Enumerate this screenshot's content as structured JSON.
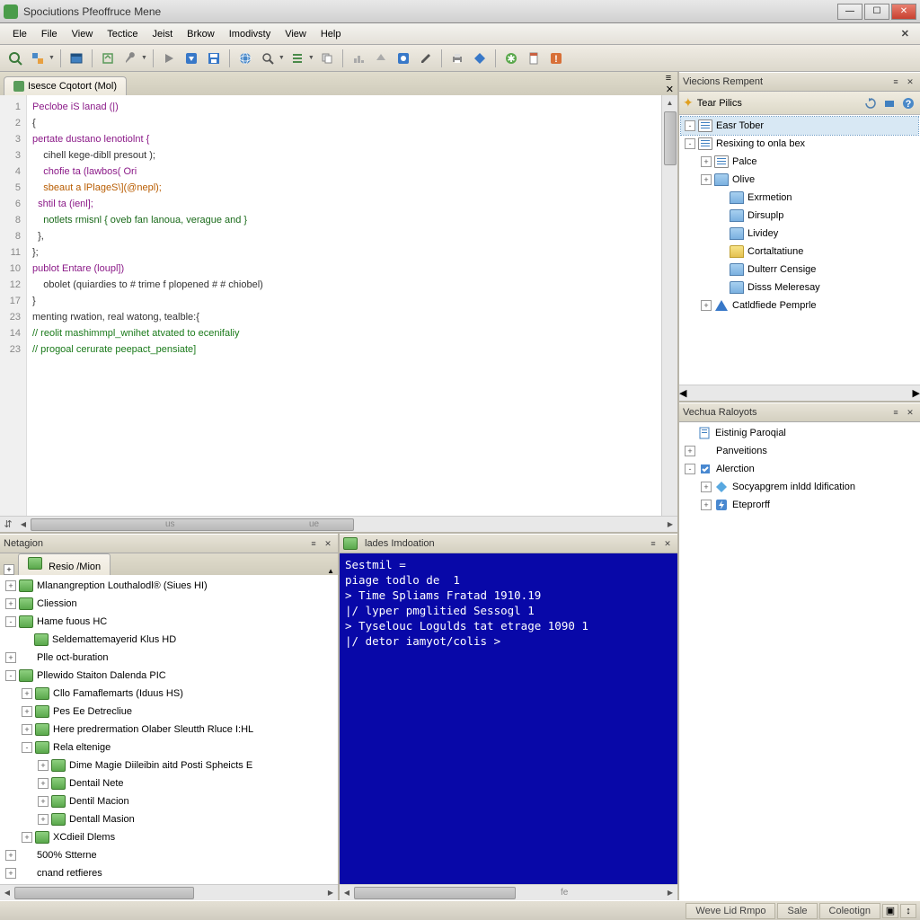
{
  "window": {
    "title": "Spociutions Pfeoffruce Mene"
  },
  "menu": {
    "items": [
      "Ele",
      "File",
      "View",
      "Tectice",
      "Jeist",
      "Brkow",
      "Imodivsty",
      "View",
      "Help"
    ]
  },
  "toolbar": {
    "icons": [
      "search",
      "puzzle",
      "window",
      "nav",
      "wrench",
      "play",
      "down",
      "save",
      "globe",
      "zoom",
      "list",
      "copy",
      "chart",
      "up",
      "box",
      "rotate",
      "pencil",
      "print",
      "diamond",
      "star",
      "page",
      "warn"
    ]
  },
  "editor": {
    "tab_label": "Isesce Cqotort (Mol)",
    "line_numbers": [
      "1",
      "2",
      "3",
      "3",
      "4",
      "5",
      "6",
      "8",
      "8",
      "",
      "11",
      "10",
      "12",
      "17",
      "23",
      "14",
      "23"
    ],
    "lines": [
      {
        "t": "Peclobe iS lanad (|)",
        "c": "kw"
      },
      {
        "t": "{",
        "c": ""
      },
      {
        "t": "pertate dustano lenotiolnt {",
        "c": "kw"
      },
      {
        "t": "    cihell kege-dibll presout );",
        "c": ""
      },
      {
        "t": "    chofie ta (lawbos( Ori",
        "c": "kw"
      },
      {
        "t": "    sbeaut a lPlageS\\](@nepl);",
        "c": "num"
      },
      {
        "t": "  shtil ta (ienl];",
        "c": "kw"
      },
      {
        "t": "    notlets rmisnl { oveb fan lanoua, verague and }",
        "c": "str"
      },
      {
        "t": "  },",
        "c": ""
      },
      {
        "t": "};",
        "c": ""
      },
      {
        "t": "",
        "c": ""
      },
      {
        "t": "publot Entare (loupl])",
        "c": "kw"
      },
      {
        "t": "    obolet (quiardies to # trime f plopened # # chiobel)",
        "c": ""
      },
      {
        "t": "}",
        "c": ""
      },
      {
        "t": "",
        "c": ""
      },
      {
        "t": "menting rwation, real watong, tealble:{",
        "c": ""
      },
      {
        "t": "// reolit mashimmpl_wnihet atvated to ecenifaliy",
        "c": "cmt"
      },
      {
        "t": "// progoal cerurate peepact_pensiate]",
        "c": "cmt"
      }
    ],
    "hscroll_labels": {
      "a": "us",
      "b": "ue"
    }
  },
  "right_panel_a": {
    "title": "Viecions Rempent",
    "toolbar_label": "Tear Pilics",
    "tree": [
      {
        "d": 0,
        "exp": "-",
        "icon": "page",
        "label": "Easr Tober",
        "sel": true
      },
      {
        "d": 0,
        "exp": "-",
        "icon": "page",
        "label": "Resixing to onla bex"
      },
      {
        "d": 1,
        "exp": "+",
        "icon": "page",
        "label": "Palce"
      },
      {
        "d": 1,
        "exp": "+",
        "icon": "bluef",
        "label": "Olive"
      },
      {
        "d": 2,
        "exp": "",
        "icon": "bluef",
        "label": "Exrmetion"
      },
      {
        "d": 2,
        "exp": "",
        "icon": "bluef",
        "label": "Dirsuplp"
      },
      {
        "d": 2,
        "exp": "",
        "icon": "bluef",
        "label": "Lividey"
      },
      {
        "d": 2,
        "exp": "",
        "icon": "folder",
        "label": "Cortaltatiune"
      },
      {
        "d": 2,
        "exp": "",
        "icon": "bluef",
        "label": "Dulterr Censige"
      },
      {
        "d": 2,
        "exp": "",
        "icon": "bluef",
        "label": "Disss Meleresay"
      },
      {
        "d": 1,
        "exp": "+",
        "icon": "tri",
        "label": "Catldfiede Pemprle"
      }
    ]
  },
  "right_panel_b": {
    "title": "Vechua Raloyots",
    "tree": [
      {
        "d": 0,
        "exp": "",
        "icon": "page-b",
        "label": "Eistinig Paroqial"
      },
      {
        "d": 0,
        "exp": "+",
        "icon": "",
        "label": "Panveitions"
      },
      {
        "d": 0,
        "exp": "-",
        "icon": "box-b",
        "label": "Alerction"
      },
      {
        "d": 1,
        "exp": "+",
        "icon": "diamond-b",
        "label": "Socyapgrem inldd ldification"
      },
      {
        "d": 1,
        "exp": "+",
        "icon": "bolt",
        "label": "Eteprorff"
      }
    ]
  },
  "nav_pane": {
    "title": "Netagion",
    "tab_label": "Resio /Mion",
    "tree": [
      {
        "d": 0,
        "exp": "+",
        "icon": "green",
        "label": "Mlanangreption Louthalodl® (Siues HI)"
      },
      {
        "d": 0,
        "exp": "+",
        "icon": "green",
        "label": "Cliession"
      },
      {
        "d": 0,
        "exp": "-",
        "icon": "green",
        "label": "Hame fuous HC"
      },
      {
        "d": 1,
        "exp": "",
        "icon": "green-sp",
        "label": "Seldemattemayerid Klus HD"
      },
      {
        "d": 0,
        "exp": "+",
        "icon": "",
        "label": "Plle oct-buration"
      },
      {
        "d": 0,
        "exp": "-",
        "icon": "green",
        "label": "Pllewido Staiton Dalenda PIC"
      },
      {
        "d": 1,
        "exp": "+",
        "icon": "green",
        "label": "Cllo Famaflemarts (Iduus HS)"
      },
      {
        "d": 1,
        "exp": "+",
        "icon": "green",
        "label": "Pes Ee Detrecliue"
      },
      {
        "d": 1,
        "exp": "+",
        "icon": "green",
        "label": "Here predrermation Olaber Sleutth Rluce I:HL"
      },
      {
        "d": 1,
        "exp": "-",
        "icon": "green",
        "label": "Rela eltenige"
      },
      {
        "d": 2,
        "exp": "+",
        "icon": "green",
        "label": "Dime Magie Diileibin aitd Posti Spheicts E"
      },
      {
        "d": 2,
        "exp": "+",
        "icon": "green",
        "label": "Dentail Nete"
      },
      {
        "d": 2,
        "exp": "+",
        "icon": "green",
        "label": "Dentil Macion"
      },
      {
        "d": 2,
        "exp": "+",
        "icon": "green",
        "label": "Dentall Masion"
      },
      {
        "d": 1,
        "exp": "+",
        "icon": "green",
        "label": "XCdieil Dlems"
      },
      {
        "d": 0,
        "exp": "+",
        "icon": "",
        "label": "500% Stterne"
      },
      {
        "d": 0,
        "exp": "+",
        "icon": "",
        "label": "cnand retfieres"
      }
    ]
  },
  "console": {
    "title": "lades Imdoation",
    "lines": [
      "Sestmil =",
      "piage todlo de  1",
      "> Time Spliams Fratad 1910.19",
      "|/ lyper pmglitied Sessogl 1",
      "> Tyselouc Logulds tat etrage 1090 1",
      "|/ detor iamyot/colis >"
    ],
    "hscroll_label": "fe"
  },
  "statusbar": {
    "items": [
      "Weve Lid Rmpo",
      "Sale",
      "Coleotign"
    ]
  }
}
